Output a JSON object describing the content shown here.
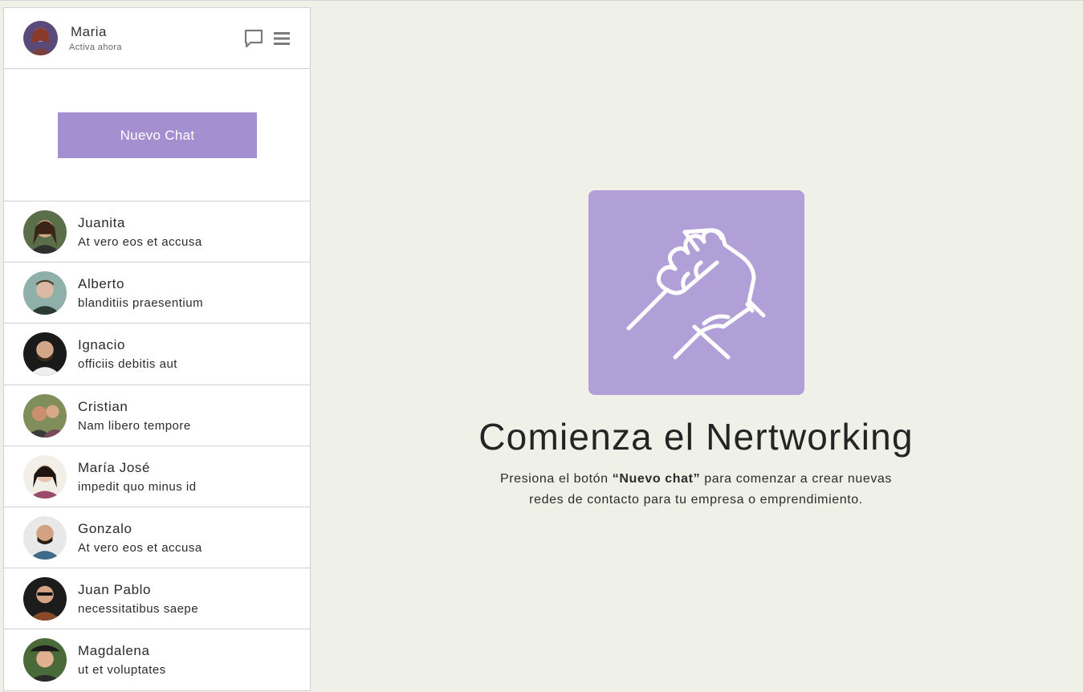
{
  "header": {
    "user_name": "Maria",
    "status": "Activa ahora",
    "icons": {
      "chat": "chat-bubble-icon",
      "menu": "menu-icon"
    }
  },
  "new_chat_label": "Nuevo Chat",
  "chats": [
    {
      "name": "Juanita",
      "preview": "At vero eos et accusa"
    },
    {
      "name": "Alberto",
      "preview": "blanditiis praesentium"
    },
    {
      "name": "Ignacio",
      "preview": "officiis debitis aut"
    },
    {
      "name": "Cristian",
      "preview": "Nam libero tempore"
    },
    {
      "name": "María José",
      "preview": "impedit quo minus id"
    },
    {
      "name": "Gonzalo",
      "preview": "At vero eos et accusa"
    },
    {
      "name": "Juan Pablo",
      "preview": "necessitatibus saepe"
    },
    {
      "name": "Magdalena",
      "preview": "ut et voluptates"
    }
  ],
  "main": {
    "icon": "handshake-icon",
    "title": "Comienza el Nertworking",
    "desc_prefix": "Presiona el botón ",
    "desc_bold": "“Nuevo chat”",
    "desc_suffix": " para comenzar a crear nuevas",
    "desc_line2": "redes de contacto para tu empresa o emprendimiento."
  },
  "colors": {
    "accent": "#a48fd1",
    "tile": "#b19fd8",
    "background": "#eff1e9",
    "sidebar": "#ffffff"
  }
}
